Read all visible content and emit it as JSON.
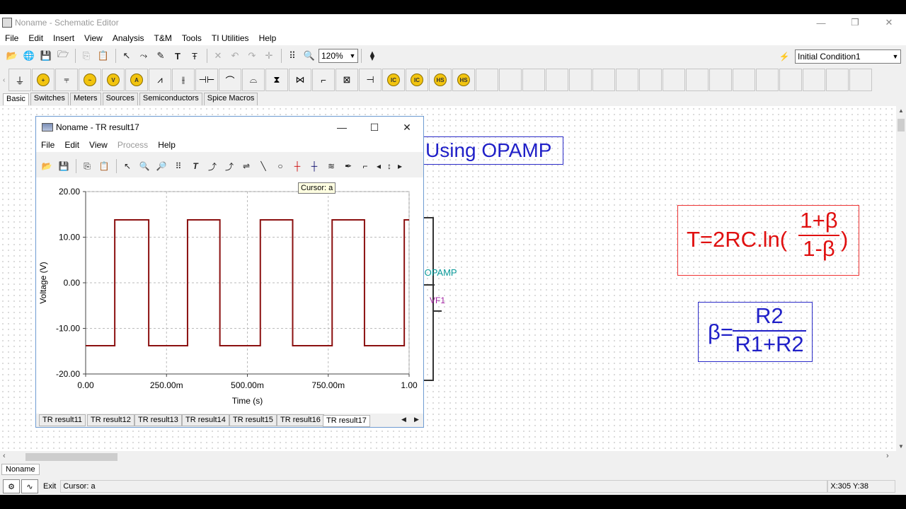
{
  "app": {
    "title": "Noname - Schematic Editor",
    "window_buttons": [
      "—",
      "❐",
      "✕"
    ],
    "menu": [
      "File",
      "Edit",
      "Insert",
      "View",
      "Analysis",
      "T&M",
      "Tools",
      "TI Utilities",
      "Help"
    ],
    "zoom": "120%",
    "initial_condition": "Initial Condition1",
    "component_tabs": [
      "Basic",
      "Switches",
      "Meters",
      "Sources",
      "Semiconductors",
      "Spice Macros"
    ],
    "active_component_tab": "Basic",
    "doc_tab": "Noname",
    "status": {
      "exit_label": "Exit",
      "message": "Cursor: a",
      "coords": "X:305  Y:38"
    }
  },
  "canvas": {
    "title_box": "Using OPAMP",
    "formula_period": {
      "lhs": "T=2RC.ln(",
      "numerator": "1+β",
      "denominator": "1-β",
      "rhs": ")"
    },
    "formula_beta": {
      "lhs": "β=",
      "numerator": "R2",
      "denominator": "R1+R2"
    },
    "opamp_label": "!OPAMP",
    "probe_label": "VF1"
  },
  "result_window": {
    "title": "Noname - TR result17",
    "menu": [
      {
        "label": "File",
        "enabled": true
      },
      {
        "label": "Edit",
        "enabled": true
      },
      {
        "label": "View",
        "enabled": true
      },
      {
        "label": "Process",
        "enabled": false
      },
      {
        "label": "Help",
        "enabled": true
      }
    ],
    "tooltip": "Cursor: a",
    "tabs": [
      "TR result11",
      "TR result12",
      "TR result13",
      "TR result14",
      "TR result15",
      "TR result16",
      "TR result17"
    ],
    "active_tab": "TR result17"
  },
  "chart_data": {
    "type": "line",
    "xlabel": "Time (s)",
    "ylabel": "Voltage (V)",
    "xlim": [
      0,
      1
    ],
    "ylim": [
      -20,
      20
    ],
    "xticks": [
      0,
      0.25,
      0.5,
      0.75,
      1.0
    ],
    "xtick_labels": [
      "0.00",
      "250.00m",
      "500.00m",
      "750.00m",
      "1.00"
    ],
    "yticks": [
      20,
      10,
      0,
      -10,
      -20
    ],
    "ytick_labels": [
      "20.00",
      "10.00",
      "0.00",
      "-10.00",
      "-20.00"
    ],
    "grid": true,
    "series": [
      {
        "color": "#8b1010",
        "x": [
          0,
          0.09,
          0.09,
          0.195,
          0.195,
          0.315,
          0.315,
          0.415,
          0.415,
          0.54,
          0.54,
          0.64,
          0.64,
          0.762,
          0.762,
          0.862,
          0.862,
          0.985,
          0.985,
          1.0
        ],
        "y": [
          -13.8,
          -13.8,
          13.8,
          13.8,
          -13.8,
          -13.8,
          13.8,
          13.8,
          -13.8,
          -13.8,
          13.8,
          13.8,
          -13.8,
          -13.8,
          13.8,
          13.8,
          -13.8,
          -13.8,
          13.8,
          13.8
        ]
      }
    ]
  }
}
